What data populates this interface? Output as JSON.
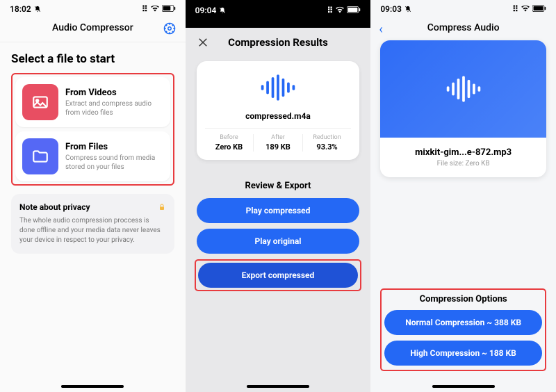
{
  "screen1": {
    "time": "18:02",
    "header_title": "Audio Compressor",
    "heading": "Select a file to start",
    "options": [
      {
        "title": "From Videos",
        "sub": "Extract and compress audio from video files"
      },
      {
        "title": "From Files",
        "sub": "Compress sound from media stored on your files"
      }
    ],
    "privacy_title": "Note about privacy",
    "privacy_text": "The whole audio compression proccess is done offline and your media data never leaves your device in respect to your privacy."
  },
  "screen2": {
    "time": "09:04",
    "title": "Compression Results",
    "filename": "compressed.m4a",
    "stats": [
      {
        "label": "Before",
        "value": "Zero KB"
      },
      {
        "label": "After",
        "value": "189 KB"
      },
      {
        "label": "Reduction",
        "value": "93.3%"
      }
    ],
    "review_title": "Review & Export",
    "buttons": {
      "play_compressed": "Play compressed",
      "play_original": "Play original",
      "export": "Export compressed"
    }
  },
  "screen3": {
    "time": "09:03",
    "title": "Compress Audio",
    "filename": "mixkit-gim...e-872.mp3",
    "filesize": "File size: Zero KB",
    "options_title": "Compression Options",
    "buttons": {
      "normal": "Normal Compression ~ 388 KB",
      "high": "High Compression ~ 188 KB"
    }
  }
}
